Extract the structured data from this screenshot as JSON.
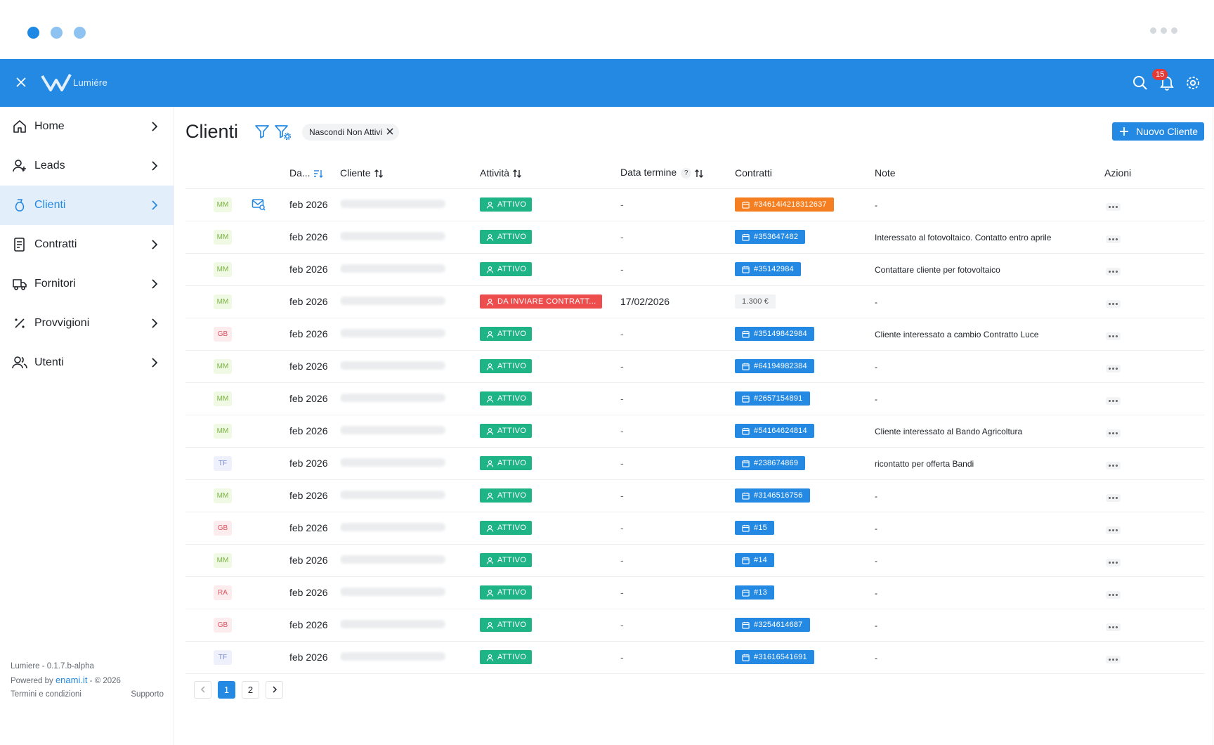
{
  "app": {
    "brand": "Lumiére",
    "notification_count": "15"
  },
  "sidebar": {
    "items": [
      {
        "label": "Home",
        "icon": "home-icon"
      },
      {
        "label": "Leads",
        "icon": "user-add-icon"
      },
      {
        "label": "Clienti",
        "icon": "client-icon",
        "active": true
      },
      {
        "label": "Contratti",
        "icon": "contract-icon"
      },
      {
        "label": "Fornitori",
        "icon": "truck-icon"
      },
      {
        "label": "Provvigioni",
        "icon": "percent-icon"
      },
      {
        "label": "Utenti",
        "icon": "users-icon"
      }
    ],
    "footer": {
      "version": "Lumiere - 0.1.7.b-alpha",
      "powered_prefix": "Powered by",
      "powered_link": "enami.it",
      "powered_suffix": "- © 2026",
      "terms": "Termini e condizioni",
      "support": "Supporto"
    }
  },
  "page": {
    "title": "Clienti",
    "filter_chip": "Nascondi Non Attivi",
    "new_button": "Nuovo Cliente"
  },
  "table": {
    "headers": {
      "date": "Da...",
      "client": "Cliente",
      "activity": "Attività",
      "deadline": "Data termine",
      "deadline_help": "?",
      "contracts": "Contratti",
      "notes": "Note",
      "actions": "Azioni"
    },
    "rows": [
      {
        "initials": "MM",
        "mail": true,
        "date": "feb 2026",
        "status": "ATTIVO",
        "status_color": "green",
        "deadline": "-",
        "contract": "#34614i4218312637",
        "contract_style": "orange",
        "note": "-"
      },
      {
        "initials": "MM",
        "mail": false,
        "date": "feb 2026",
        "status": "ATTIVO",
        "status_color": "green",
        "deadline": "-",
        "contract": "#353647482",
        "contract_style": "blue",
        "note": "Interessato al fotovoltaico. Contatto entro aprile"
      },
      {
        "initials": "MM",
        "mail": false,
        "date": "feb 2026",
        "status": "ATTIVO",
        "status_color": "green",
        "deadline": "-",
        "contract": "#35142984",
        "contract_style": "blue",
        "note": "Contattare cliente per fotovoltaico"
      },
      {
        "initials": "MM",
        "mail": false,
        "date": "feb 2026",
        "status": "DA INVIARE CONTRATT...",
        "status_color": "red",
        "deadline": "17/02/2026",
        "contract": "1.300 €",
        "contract_style": "gray",
        "note": "-"
      },
      {
        "initials": "GB",
        "mail": false,
        "date": "feb 2026",
        "status": "ATTIVO",
        "status_color": "green",
        "deadline": "-",
        "contract": "#35149842984",
        "contract_style": "blue",
        "note": "Cliente interessato a cambio Contratto Luce"
      },
      {
        "initials": "MM",
        "mail": false,
        "date": "feb 2026",
        "status": "ATTIVO",
        "status_color": "green",
        "deadline": "-",
        "contract": "#64194982384",
        "contract_style": "blue",
        "note": "-"
      },
      {
        "initials": "MM",
        "mail": false,
        "date": "feb 2026",
        "status": "ATTIVO",
        "status_color": "green",
        "deadline": "-",
        "contract": "#2657154891",
        "contract_style": "blue",
        "note": "-"
      },
      {
        "initials": "MM",
        "mail": false,
        "date": "feb 2026",
        "status": "ATTIVO",
        "status_color": "green",
        "deadline": "-",
        "contract": "#54164624814",
        "contract_style": "blue",
        "note": "Cliente interessato al Bando Agricoltura"
      },
      {
        "initials": "TF",
        "mail": false,
        "date": "feb 2026",
        "status": "ATTIVO",
        "status_color": "green",
        "deadline": "-",
        "contract": "#238674869",
        "contract_style": "blue",
        "note": "ricontatto per offerta Bandi"
      },
      {
        "initials": "MM",
        "mail": false,
        "date": "feb 2026",
        "status": "ATTIVO",
        "status_color": "green",
        "deadline": "-",
        "contract": "#3146516756",
        "contract_style": "blue",
        "note": "-"
      },
      {
        "initials": "GB",
        "mail": false,
        "date": "feb 2026",
        "status": "ATTIVO",
        "status_color": "green",
        "deadline": "-",
        "contract": "#15",
        "contract_style": "blue",
        "note": "-"
      },
      {
        "initials": "MM",
        "mail": false,
        "date": "feb 2026",
        "status": "ATTIVO",
        "status_color": "green",
        "deadline": "-",
        "contract": "#14",
        "contract_style": "blue",
        "note": "-"
      },
      {
        "initials": "RA",
        "mail": false,
        "date": "feb 2026",
        "status": "ATTIVO",
        "status_color": "green",
        "deadline": "-",
        "contract": "#13",
        "contract_style": "blue",
        "note": "-"
      },
      {
        "initials": "GB",
        "mail": false,
        "date": "feb 2026",
        "status": "ATTIVO",
        "status_color": "green",
        "deadline": "-",
        "contract": "#3254614687",
        "contract_style": "blue",
        "note": "-"
      },
      {
        "initials": "TF",
        "mail": false,
        "date": "feb 2026",
        "status": "ATTIVO",
        "status_color": "green",
        "deadline": "-",
        "contract": "#31616541691",
        "contract_style": "blue",
        "note": "-"
      }
    ]
  },
  "pagination": {
    "pages": [
      "1",
      "2"
    ],
    "current": "1"
  },
  "colors": {
    "primary": "#2489e3",
    "active_status": "#1fb486",
    "alert_status": "#ee4d4d",
    "contract_warn": "#f57f20"
  }
}
